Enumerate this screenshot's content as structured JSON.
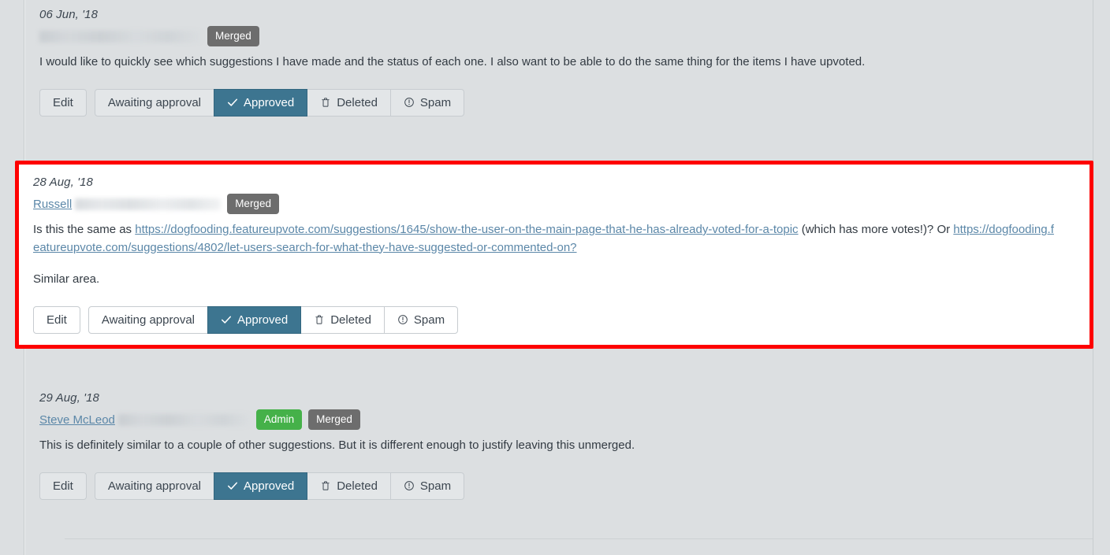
{
  "theme": {
    "page_bg": "#dcdfe1",
    "highlight_border": "#fe0000",
    "accent_active": "#3d7590",
    "link": "#5b87a8",
    "badge_merged_bg": "#6d6d6d",
    "badge_admin_bg": "#45b149"
  },
  "actions": {
    "edit": "Edit",
    "awaiting": "Awaiting approval",
    "approved": "Approved",
    "deleted": "Deleted",
    "spam": "Spam"
  },
  "badges": {
    "merged": "Merged",
    "admin": "Admin"
  },
  "comments": [
    {
      "date": "06 Jun, '18",
      "author": "",
      "author_redacted": true,
      "badges": [
        "Merged"
      ],
      "paragraphs": [
        "I would like to quickly see which suggestions I have made and the status of each one. I also want to be able to do the same thing for the items I have upvoted."
      ],
      "highlighted": false
    },
    {
      "date": "28 Aug, '18",
      "author": "Russell",
      "author_redacted": true,
      "badges": [
        "Merged"
      ],
      "paragraphs": [
        "Is this the same as https://dogfooding.featureupvote.com/suggestions/1645/show-the-user-on-the-main-page-that-he-has-already-voted-for-a-topic (which has more votes!)? Or https://dogfooding.featureupvote.com/suggestions/4802/let-users-search-for-what-they-have-suggested-or-commented-on?",
        "Similar area."
      ],
      "links": [
        "https://dogfooding.featureupvote.com/suggestions/1645/show-the-user-on-the-main-page-that-he-has-already-voted-for-a-topic",
        "https://dogfooding.featureupvote.com/suggestions/4802/let-users-search-for-what-they-have-suggested-or-commented-on?"
      ],
      "text_parts": {
        "pre": "Is this the same as ",
        "mid": " (which has more votes!)? Or ",
        "post": ""
      },
      "highlighted": true
    },
    {
      "date": "29 Aug, '18",
      "author": "Steve McLeod",
      "author_redacted": true,
      "badges": [
        "Admin",
        "Merged"
      ],
      "paragraphs": [
        "This is definitely similar to a couple of other suggestions. But it is different enough to justify leaving this unmerged."
      ],
      "highlighted": false
    }
  ]
}
